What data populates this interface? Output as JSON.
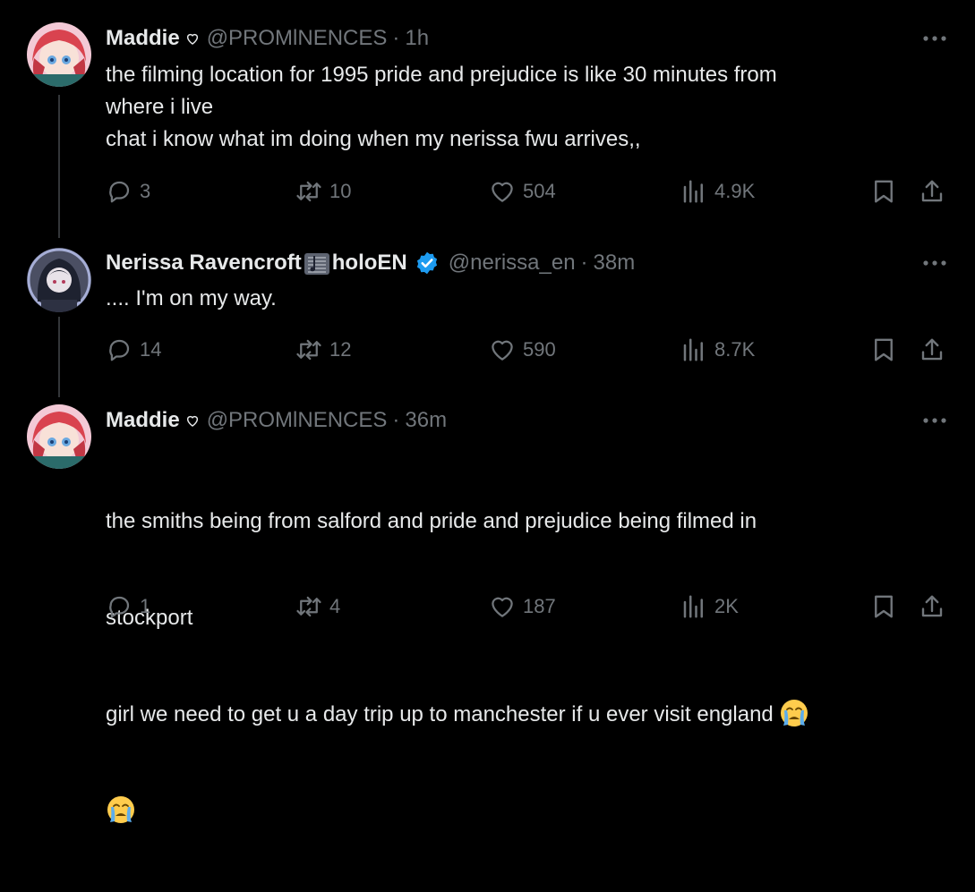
{
  "tweets": [
    {
      "name": "Maddie",
      "handle": "@PROMlNENCES",
      "time": "1h",
      "text": "the filming location for 1995 pride and prejudice is like 30 minutes from\nwhere i live\nchat i know what im doing when my nerissa fwu arrives,,",
      "replies": "3",
      "retweets": "10",
      "likes": "504",
      "views": "4.9K"
    },
    {
      "name_prefix": "Nerissa Ravencroft",
      "name_suffix": "holoEN",
      "handle": "@nerissa_en",
      "time": "38m",
      "text": ".... I'm on my way.",
      "replies": "14",
      "retweets": "12",
      "likes": "590",
      "views": "8.7K"
    },
    {
      "name": "Maddie",
      "handle": "@PROMlNENCES",
      "time": "36m",
      "text_line1": "the smiths being from salford and pride and prejudice being filmed in",
      "text_line2": "stockport",
      "text_line3": "girl we need to get u a day trip up to manchester if u ever visit england",
      "replies": "1",
      "retweets": "4",
      "likes": "187",
      "views": "2K"
    }
  ],
  "dot": "·",
  "colors": {
    "background": "#000000",
    "text": "#e7e9ea",
    "muted": "#71767b",
    "verified": "#1d9bf0",
    "thread_line": "#333639"
  },
  "icons": [
    "reply-icon",
    "retweet-icon",
    "like-icon",
    "views-icon",
    "bookmark-icon",
    "share-icon",
    "more-icon",
    "heart-badge-icon",
    "verified-badge-icon",
    "music-score-icon",
    "crying-face-emoji"
  ]
}
